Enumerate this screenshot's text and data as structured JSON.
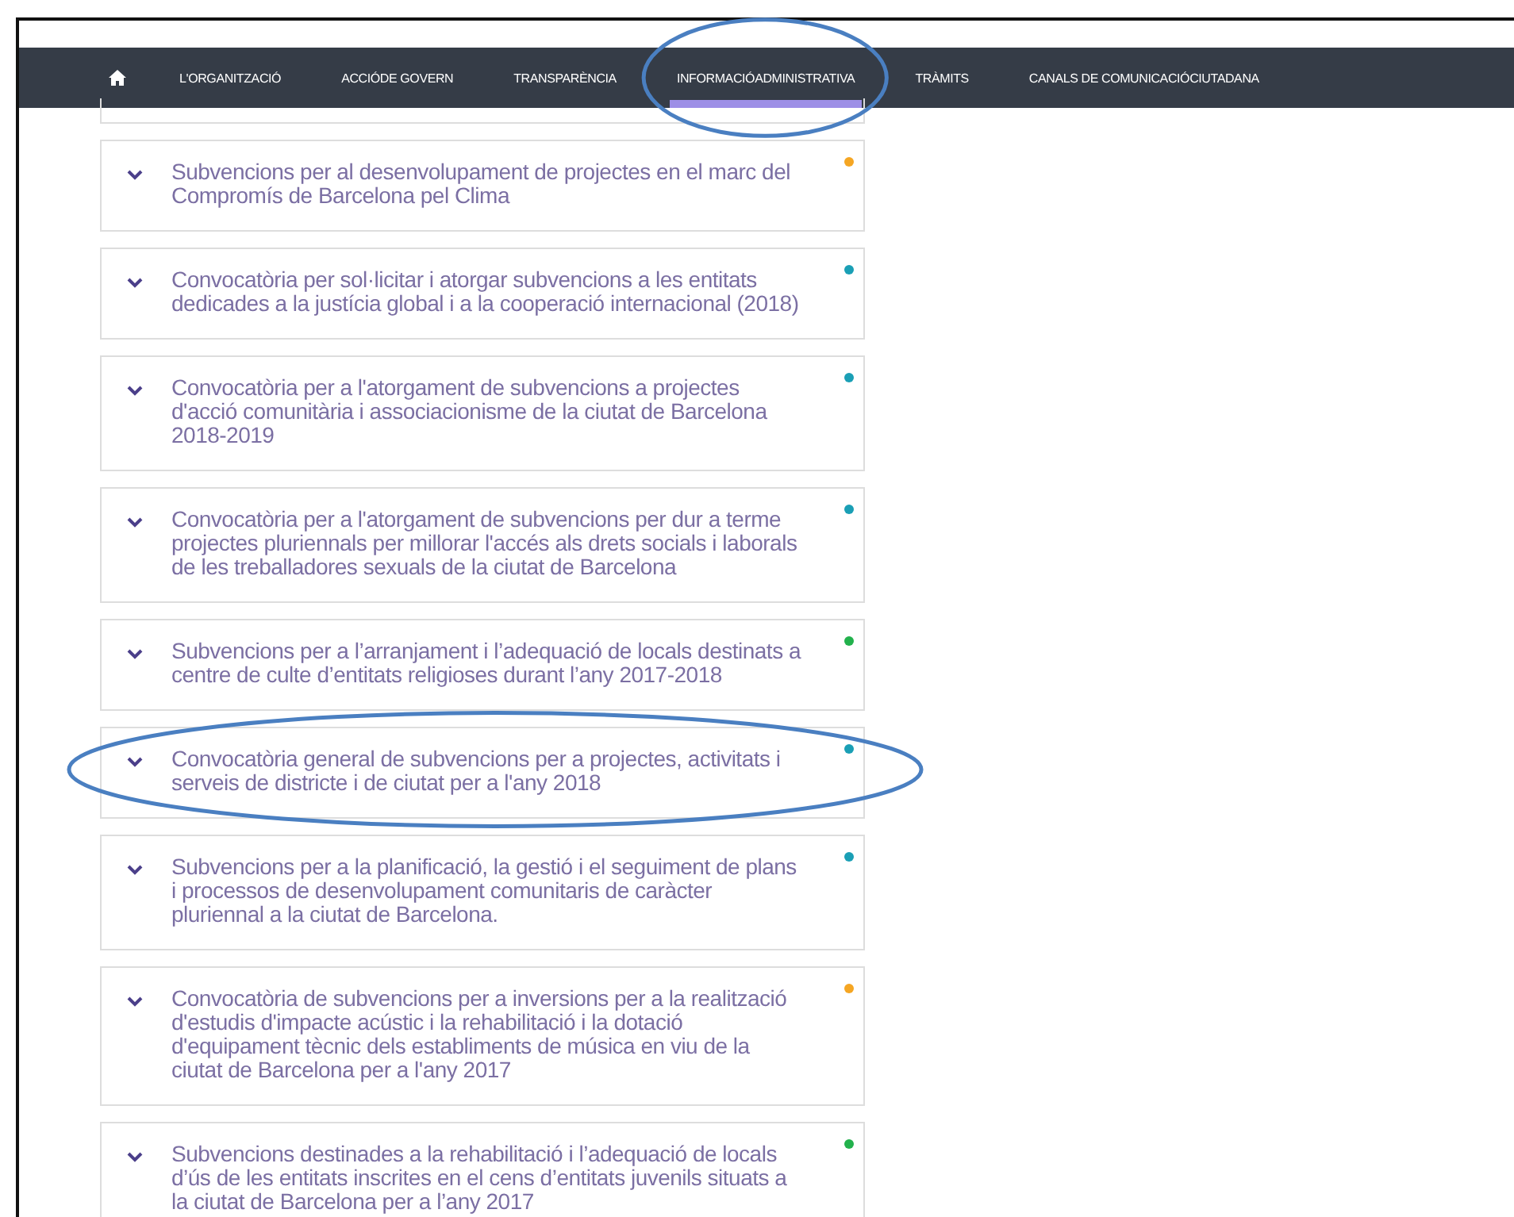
{
  "nav": {
    "items": [
      {
        "label": "L'ORGANITZACIÓ",
        "selected": false,
        "circled": false
      },
      {
        "label": "ACCIÓDE GOVERN",
        "selected": false,
        "circled": false
      },
      {
        "label": "TRANSPARÈNCIA",
        "selected": false,
        "circled": false
      },
      {
        "label": "INFORMACIÓADMINISTRATIVA",
        "selected": true,
        "circled": true
      },
      {
        "label": "TRÀMITS",
        "selected": false,
        "circled": false
      },
      {
        "label": "CANALS DE COMUNICACIÓCIUTADANA",
        "selected": false,
        "circled": false
      }
    ]
  },
  "grants": [
    {
      "title": "Subvencions per al desenvolupament de projectes en el marc del Compromís de Barcelona pel Clima",
      "color": "#f5a623",
      "circled": false
    },
    {
      "title": "Convocatòria per sol·licitar i atorgar subvencions a les entitats dedicades a la justícia global i a la cooperació internacional (2018)",
      "color": "#1a9fb5",
      "circled": false
    },
    {
      "title": "Convocatòria per a l'atorgament de subvencions a projectes d'acció comunitària i associacionisme de la ciutat de Barcelona 2018-2019",
      "color": "#1a9fb5",
      "circled": false
    },
    {
      "title": "Convocatòria per a l'atorgament de subvencions per dur a terme projectes pluriennals per millorar l'accés als drets socials i laborals de les treballadores sexuals de la ciutat de Barcelona",
      "color": "#1a9fb5",
      "circled": false
    },
    {
      "title": "Subvencions per a l’arranjament i l’adequació de locals destinats a centre de culte d’entitats religioses durant l’any 2017-2018",
      "color": "#22b14c",
      "circled": false
    },
    {
      "title": "Convocatòria general de subvencions per a projectes, activitats i serveis de districte i de ciutat per a l'any 2018",
      "color": "#1a9fb5",
      "circled": true
    },
    {
      "title": "Subvencions per a la planificació, la gestió i el seguiment de plans i processos de desenvolupament comunitaris de caràcter pluriennal a la ciutat de Barcelona.",
      "color": "#1a9fb5",
      "circled": false
    },
    {
      "title": "Convocatòria de subvencions per a inversions per a la realització d'estudis d'impacte acústic i la rehabilitació i la dotació d'equipament tècnic dels establiments de música en viu de la ciutat de Barcelona per a l'any 2017",
      "color": "#f5a623",
      "circled": false
    },
    {
      "title": "Subvencions destinades a la rehabilitació i l’adequació de locals d’ús de les entitats inscrites en el cens d’entitats juvenils situats a la ciutat de Barcelona per a l’any 2017",
      "color": "#22b14c",
      "circled": false
    }
  ]
}
